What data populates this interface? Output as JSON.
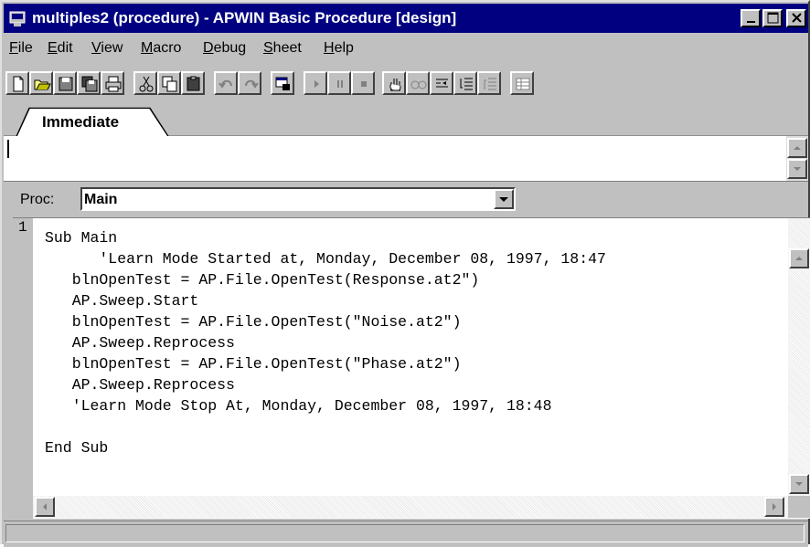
{
  "window": {
    "title": "multiples2 (procedure) - APWIN Basic Procedure [design]",
    "title_bar_color": "#000080"
  },
  "menu": [
    {
      "underline": "F",
      "rest": "ile"
    },
    {
      "underline": "E",
      "rest": "dit"
    },
    {
      "underline": "V",
      "rest": "iew"
    },
    {
      "underline": "M",
      "rest": "acro"
    },
    {
      "underline": "D",
      "rest": "ebug"
    },
    {
      "underline": "S",
      "rest": "heet"
    },
    {
      "underline": "H",
      "rest": "elp"
    }
  ],
  "toolbar_icons": [
    "new-icon",
    "open-icon",
    "save-icon",
    "save-all-icon",
    "print-icon",
    "cut-icon",
    "copy-icon",
    "paste-icon",
    "undo-icon",
    "redo-icon",
    "dialog-editor-icon",
    "run-icon",
    "pause-icon",
    "stop-icon",
    "toggle-breakpoint-icon",
    "quick-watch-icon",
    "step-into-icon",
    "step-over-icon",
    "step-out-icon",
    "sheet-icon"
  ],
  "immediate": {
    "tab_label": "Immediate",
    "content": ""
  },
  "proc": {
    "label": "Proc:",
    "value": "Main"
  },
  "editor": {
    "line_number": "1",
    "lines": [
      "Sub Main",
      "      'Learn Mode Started at, Monday, December 08, 1997, 18:47",
      "   blnOpenTest = AP.File.OpenTest(Response.at2\")",
      "   AP.Sweep.Start",
      "   blnOpenTest = AP.File.OpenTest(\"Noise.at2\")",
      "   AP.Sweep.Reprocess",
      "   blnOpenTest = AP.File.OpenTest(\"Phase.at2\")",
      "   AP.Sweep.Reprocess",
      "   'Learn Mode Stop At, Monday, December 08, 1997, 18:48",
      "",
      "End Sub"
    ]
  },
  "status_bar": {
    "text": ""
  }
}
